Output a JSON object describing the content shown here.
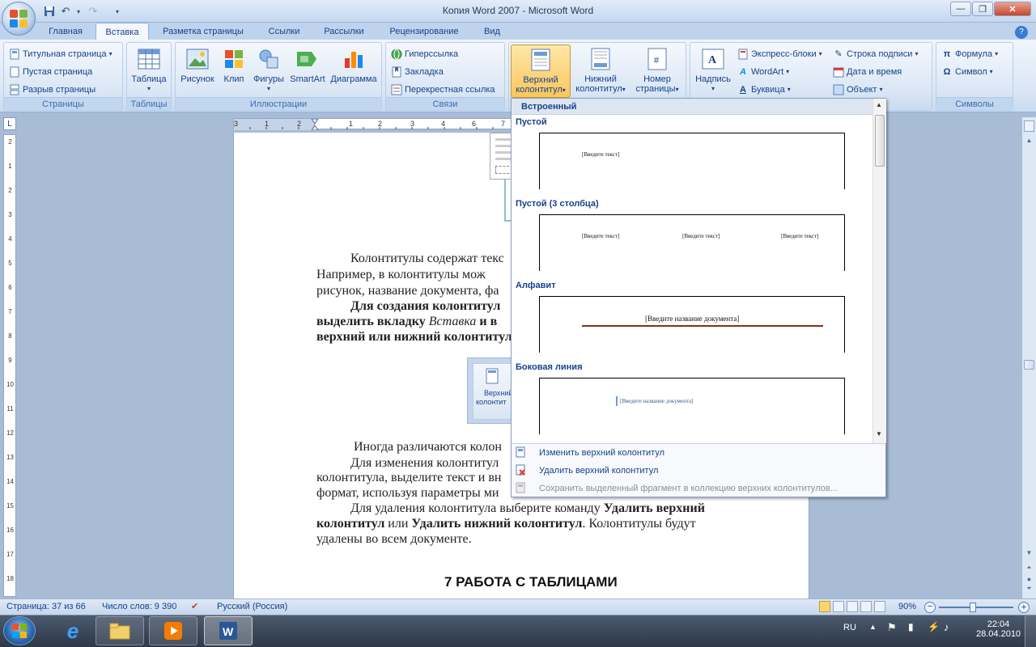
{
  "window": {
    "title": "Копия Word 2007 - Microsoft Word"
  },
  "tabs": [
    "Главная",
    "Вставка",
    "Разметка страницы",
    "Ссылки",
    "Рассылки",
    "Рецензирование",
    "Вид"
  ],
  "ribbon": {
    "pages_group": {
      "label": "Страницы",
      "cover": "Титульная страница",
      "blank": "Пустая страница",
      "break": "Разрыв страницы"
    },
    "tables_group": {
      "label": "Таблицы",
      "table": "Таблица"
    },
    "illustrations_group": {
      "label": "Иллюстрации",
      "picture": "Рисунок",
      "clip": "Клип",
      "shapes": "Фигуры",
      "smartart": "SmartArt",
      "chart": "Диаграмма"
    },
    "links_group": {
      "label": "Связи",
      "hyperlink": "Гиперссылка",
      "bookmark": "Закладка",
      "crossref": "Перекрестная ссылка"
    },
    "hf_group": {
      "header_l1": "Верхний",
      "header_l2": "колонтитул",
      "footer_l1": "Нижний",
      "footer_l2": "колонтитул",
      "pagenum_l1": "Номер",
      "pagenum_l2": "страницы"
    },
    "text_group": {
      "textbox": "Надпись",
      "quickparts": "Экспресс-блоки",
      "wordart": "WordArt",
      "dropcap": "Буквица",
      "sigline": "Строка подписи",
      "datetime": "Дата и время",
      "object": "Объект"
    },
    "symbols_group": {
      "label": "Символы",
      "equation": "Формула",
      "symbol": "Символ"
    }
  },
  "gallery": {
    "heading": "Встроенный",
    "sections": [
      {
        "name": "Пустой",
        "placeholders": [
          "[Введите текст]"
        ]
      },
      {
        "name": "Пустой (3 столбца)",
        "placeholders": [
          "[Введите текст]",
          "[Введите текст]",
          "[Введите текст]"
        ]
      },
      {
        "name": "Алфавит",
        "placeholders": [
          "[Введите название документа]"
        ]
      },
      {
        "name": "Боковая линия",
        "placeholders": [
          "[Введите название документа]"
        ]
      }
    ],
    "commands": {
      "edit": "Изменить верхний колонтитул",
      "remove": "Удалить верхний колонтитул",
      "save": "Сохранить выделенный фрагмент в коллекцию верхних колонтитулов..."
    }
  },
  "document": {
    "p1_l1": "Колонтитулы содержат текс",
    "p1_l2": "Например, в колонтитулы мож",
    "p1_l3": "рисунок, название документа, фа",
    "p2_l1": "Для создания колонтитул",
    "p2_l2a": "выделить вкладку ",
    "p2_l2b": "Вставка",
    "p2_l2c": " и в",
    "p2_l3": "верхний или нижний колонтитул",
    "img_l1": "Верхний",
    "img_l2": "колонтит",
    "p3_l1": "Иногда различаются колон",
    "p4_l1": "Для изменения колонтитул",
    "p4_l2": "колонтитула, выделите текст и вн",
    "p4_l3": "формат, используя параметры ми",
    "p5_l1a": "Для удаления колонтитула выберите команду ",
    "p5_l1b": "Удалить верхний",
    "p5_l2a": "колонтитул",
    "p5_l2b": " или ",
    "p5_l2c": "Удалить нижний колонтитул",
    "p5_l2d": ". Колонтитулы будут",
    "p5_l3": "удалены во всем документе.",
    "heading": "7 РАБОТА С ТАБЛИЦАМИ"
  },
  "hruler_numbers": [
    "3",
    "1",
    "2",
    "1",
    "1",
    "2",
    "3",
    "4",
    "5",
    "6",
    "7"
  ],
  "vruler_numbers": [
    "2",
    "1",
    "2",
    "3",
    "4",
    "5",
    "6",
    "7",
    "8",
    "9",
    "10",
    "11",
    "12",
    "13",
    "14",
    "15",
    "16",
    "17",
    "18"
  ],
  "status": {
    "page": "Страница: 37 из 66",
    "words": "Число слов: 9 390",
    "lang": "Русский (Россия)",
    "zoom": "90%"
  },
  "tray": {
    "lang": "RU",
    "time": "22:04",
    "date": "28.04.2010"
  },
  "colors": {
    "accent": "#15428b",
    "pressed": "#fbc65d",
    "taskbar": "#2d3848"
  }
}
